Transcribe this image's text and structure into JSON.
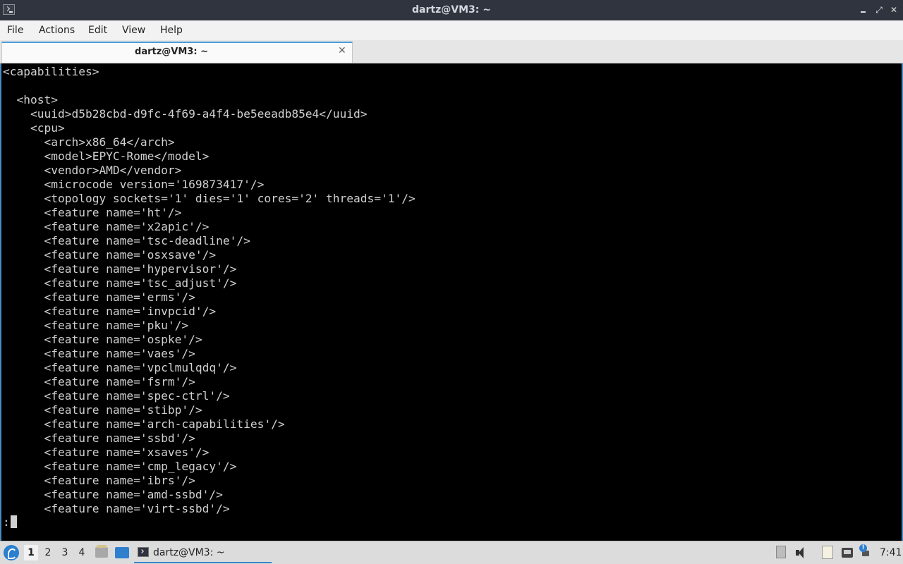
{
  "window": {
    "title": "dartz@VM3: ~",
    "app_icon": "terminal-icon",
    "controls": {
      "min": "minimize-icon",
      "max": "⤢",
      "close": "✕"
    }
  },
  "menu": [
    "File",
    "Actions",
    "Edit",
    "View",
    "Help"
  ],
  "tabs": [
    {
      "label": "dartz@VM3: ~",
      "close": "✕"
    }
  ],
  "terminal": {
    "lines": [
      "<capabilities>",
      "",
      "  <host>",
      "    <uuid>d5b28cbd-d9fc-4f69-a4f4-be5eeadb85e4</uuid>",
      "    <cpu>",
      "      <arch>x86_64</arch>",
      "      <model>EPYC-Rome</model>",
      "      <vendor>AMD</vendor>",
      "      <microcode version='169873417'/>",
      "      <topology sockets='1' dies='1' cores='2' threads='1'/>",
      "      <feature name='ht'/>",
      "      <feature name='x2apic'/>",
      "      <feature name='tsc-deadline'/>",
      "      <feature name='osxsave'/>",
      "      <feature name='hypervisor'/>",
      "      <feature name='tsc_adjust'/>",
      "      <feature name='erms'/>",
      "      <feature name='invpcid'/>",
      "      <feature name='pku'/>",
      "      <feature name='ospke'/>",
      "      <feature name='vaes'/>",
      "      <feature name='vpclmulqdq'/>",
      "      <feature name='fsrm'/>",
      "      <feature name='spec-ctrl'/>",
      "      <feature name='stibp'/>",
      "      <feature name='arch-capabilities'/>",
      "      <feature name='ssbd'/>",
      "      <feature name='xsaves'/>",
      "      <feature name='cmp_legacy'/>",
      "      <feature name='ibrs'/>",
      "      <feature name='amd-ssbd'/>",
      "      <feature name='virt-ssbd'/>"
    ],
    "prompt": ":"
  },
  "taskbar": {
    "workspaces": [
      "1",
      "2",
      "3",
      "4"
    ],
    "active_workspace": "1",
    "task_label": "dartz@VM3: ~",
    "notify_badge": "!",
    "clock": "7:41"
  }
}
